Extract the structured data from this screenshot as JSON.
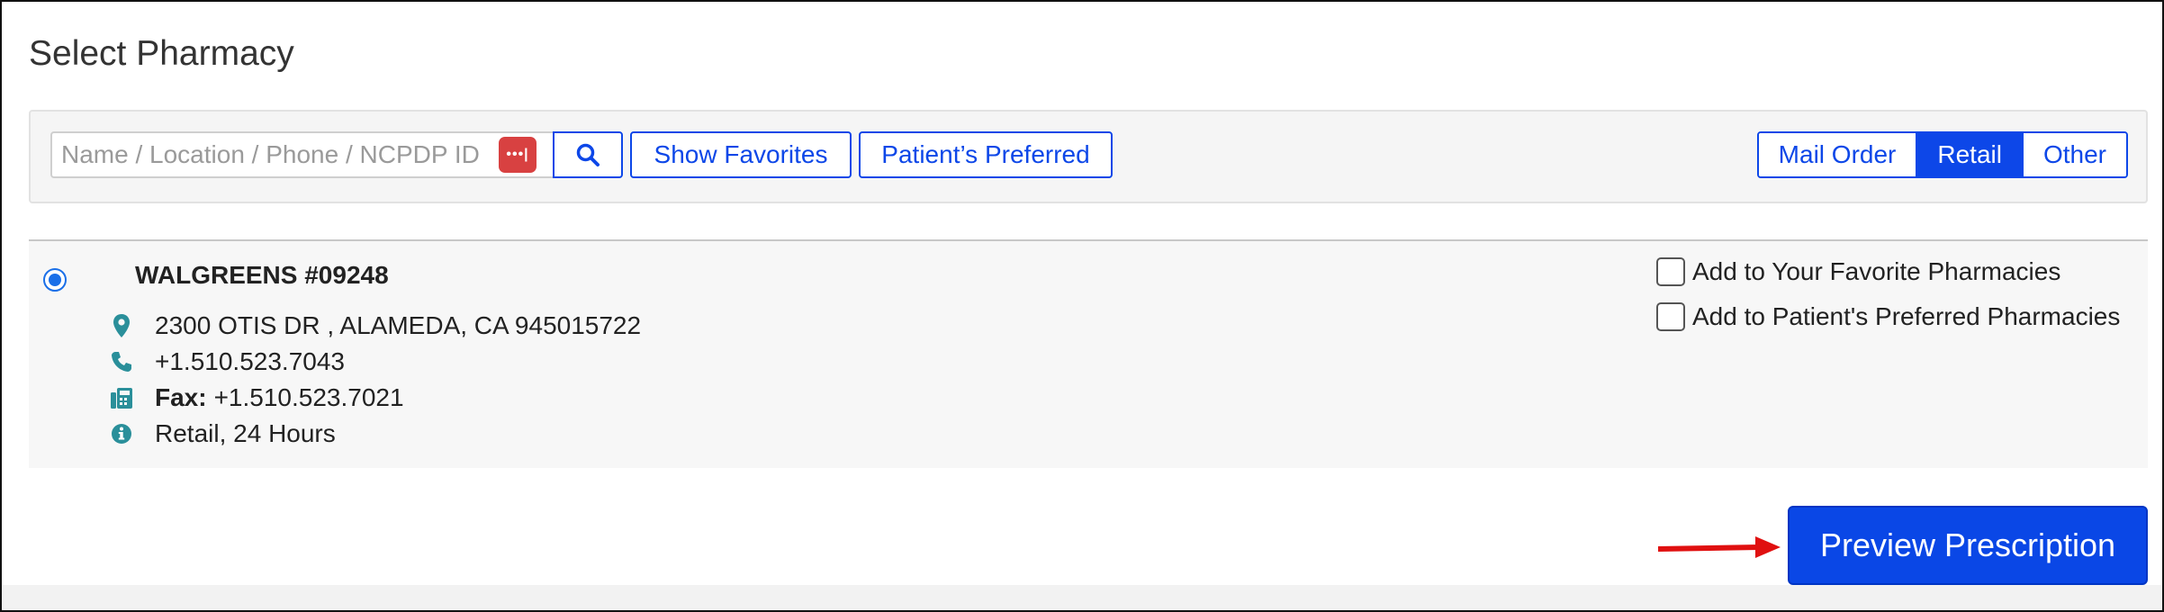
{
  "page": {
    "title": "Select Pharmacy"
  },
  "search": {
    "placeholder": "Name / Location / Phone / NCPDP ID",
    "value": "",
    "password_icon_label": "•••|"
  },
  "toolbar": {
    "show_favorites": "Show Favorites",
    "patients_preferred": "Patient’s Preferred"
  },
  "filters": {
    "options": [
      {
        "label": "Mail Order",
        "selected": false
      },
      {
        "label": "Retail",
        "selected": true
      },
      {
        "label": "Other",
        "selected": false
      }
    ]
  },
  "pharmacy": {
    "selected": true,
    "name": "WALGREENS #09248",
    "address": "2300 OTIS DR , ALAMEDA, CA 945015722",
    "phone": "+1.510.523.7043",
    "fax_label": "Fax:",
    "fax": "+1.510.523.7021",
    "info": "Retail, 24 Hours",
    "add_favorite": "Add to Your Favorite Pharmacies",
    "add_preferred": "Add to Patient's Preferred Pharmacies",
    "add_favorite_checked": false,
    "add_preferred_checked": false
  },
  "footer": {
    "preview_button": "Preview Prescription"
  },
  "colors": {
    "accent": "#0d47e8",
    "icon_teal": "#2a8f9a",
    "arrow_red": "#e01010",
    "password_icon_bg": "#d84141"
  },
  "icons": [
    "search-icon",
    "password-manager-icon",
    "map-marker-icon",
    "phone-icon",
    "fax-icon",
    "info-icon",
    "red-arrow-icon"
  ]
}
